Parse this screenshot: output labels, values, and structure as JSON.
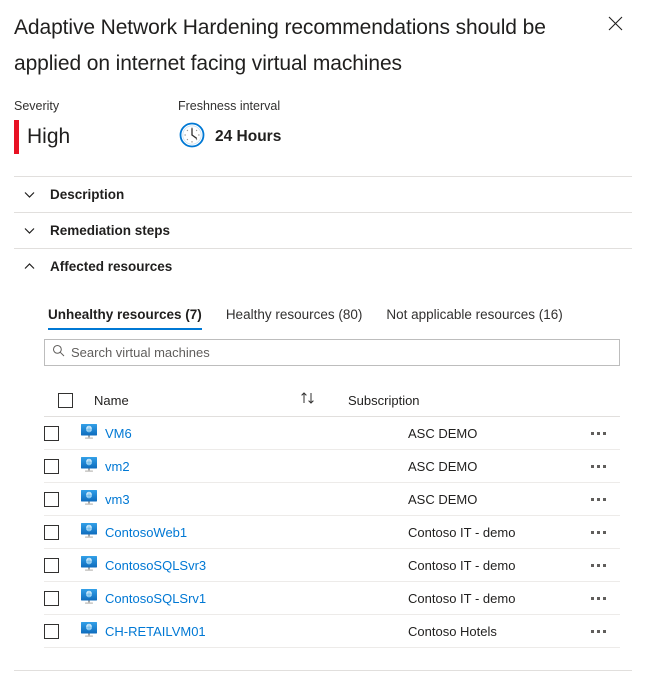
{
  "header": {
    "title": "Adaptive Network Hardening recommendations should be applied on internet facing virtual machines",
    "close_label": "Close"
  },
  "meta": {
    "severity": {
      "label": "Severity",
      "value": "High",
      "color": "#e81123"
    },
    "freshness": {
      "label": "Freshness interval",
      "value": "24 Hours",
      "icon": "clock-icon"
    }
  },
  "accordions": [
    {
      "label": "Description",
      "expanded": false,
      "icon": "chevron-down-icon"
    },
    {
      "label": "Remediation steps",
      "expanded": false,
      "icon": "chevron-down-icon"
    },
    {
      "label": "Affected resources",
      "expanded": true,
      "icon": "chevron-up-icon"
    }
  ],
  "tabs": [
    {
      "label": "Unhealthy resources (7)",
      "active": true
    },
    {
      "label": "Healthy resources (80)",
      "active": false
    },
    {
      "label": "Not applicable resources (16)",
      "active": false
    }
  ],
  "search": {
    "placeholder": "Search virtual machines",
    "value": "",
    "icon": "search-icon"
  },
  "table": {
    "columns": {
      "name": "Name",
      "subscription": "Subscription",
      "sort_icon": "sort-ascending-descending-icon"
    },
    "rows": [
      {
        "name": "VM6",
        "subscription": "ASC DEMO",
        "icon": "virtual-machine-icon"
      },
      {
        "name": "vm2",
        "subscription": "ASC DEMO",
        "icon": "virtual-machine-icon"
      },
      {
        "name": "vm3",
        "subscription": "ASC DEMO",
        "icon": "virtual-machine-icon"
      },
      {
        "name": "ContosoWeb1",
        "subscription": "Contoso IT - demo",
        "icon": "virtual-machine-icon"
      },
      {
        "name": "ContosoSQLSvr3",
        "subscription": "Contoso IT - demo",
        "icon": "virtual-machine-icon"
      },
      {
        "name": "ContosoSQLSrv1",
        "subscription": "Contoso IT - demo",
        "icon": "virtual-machine-icon"
      },
      {
        "name": "CH-RETAILVM01",
        "subscription": "Contoso Hotels",
        "icon": "virtual-machine-icon"
      }
    ],
    "row_menu_icon": "more-options-icon"
  },
  "colors": {
    "accent": "#0078d4",
    "link": "#0078d4",
    "severity_high": "#e81123",
    "text": "#201f1e",
    "divider": "#e1dfdd"
  }
}
